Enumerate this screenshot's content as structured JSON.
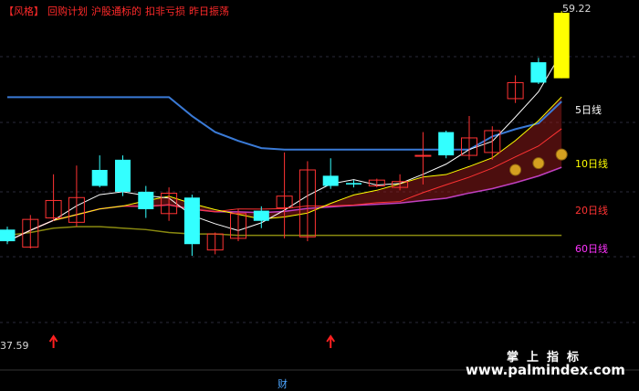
{
  "signals": {
    "style_tag": "【风格】",
    "items": [
      "回购计划",
      "沪股通标的",
      "扣非亏损",
      "昨日振荡"
    ]
  },
  "ma_labels": [
    {
      "key": "ma5",
      "text": "5日线",
      "color": "#ffffff"
    },
    {
      "key": "ma10",
      "text": "10日线",
      "color": "#ffff00"
    },
    {
      "key": "ma20",
      "text": "20日线",
      "color": "#ff3333"
    },
    {
      "key": "ma60",
      "text": "60日线",
      "color": "#ff33ff"
    }
  ],
  "price_low_label": "37.59",
  "price_high_label": "59.22",
  "finance_mark": "财",
  "watermark": {
    "cn": "掌上指标",
    "url": "www.palmindex.com"
  },
  "colors": {
    "up": "#ff3333",
    "down": "#33ffff",
    "limit_up": "#ffff00",
    "blue_line": "#3a7ad6",
    "olive_line": "#8a8a10",
    "purple_line": "#c040c0",
    "green_band": "#0a7a3a",
    "red_band": "#8a1a1a"
  },
  "chart_data": {
    "type": "candlestick",
    "candles": [
      {
        "o": 44.2,
        "c": 43.4,
        "h": 44.4,
        "l": 43.2,
        "dir": "down"
      },
      {
        "o": 43.0,
        "c": 44.9,
        "h": 45.2,
        "l": 42.9,
        "dir": "up"
      },
      {
        "o": 45.0,
        "c": 46.2,
        "h": 48.0,
        "l": 44.8,
        "dir": "up"
      },
      {
        "o": 44.7,
        "c": 46.4,
        "h": 48.6,
        "l": 44.4,
        "dir": "up"
      },
      {
        "o": 48.3,
        "c": 47.2,
        "h": 49.3,
        "l": 47.1,
        "dir": "down"
      },
      {
        "o": 49.0,
        "c": 46.8,
        "h": 49.3,
        "l": 46.5,
        "dir": "down"
      },
      {
        "o": 46.8,
        "c": 45.6,
        "h": 47.2,
        "l": 45.0,
        "dir": "down"
      },
      {
        "o": 45.3,
        "c": 46.7,
        "h": 47.1,
        "l": 44.8,
        "dir": "up"
      },
      {
        "o": 46.4,
        "c": 43.2,
        "h": 46.6,
        "l": 42.4,
        "dir": "down"
      },
      {
        "o": 42.8,
        "c": 43.9,
        "h": 44.0,
        "l": 42.5,
        "dir": "up"
      },
      {
        "o": 43.6,
        "c": 45.3,
        "h": 45.6,
        "l": 43.4,
        "dir": "up"
      },
      {
        "o": 45.5,
        "c": 44.8,
        "h": 45.8,
        "l": 44.3,
        "dir": "down"
      },
      {
        "o": 45.7,
        "c": 46.5,
        "h": 49.5,
        "l": 43.6,
        "dir": "up"
      },
      {
        "o": 43.7,
        "c": 48.3,
        "h": 48.9,
        "l": 43.4,
        "dir": "up"
      },
      {
        "o": 47.9,
        "c": 47.2,
        "h": 49.1,
        "l": 47.0,
        "dir": "down"
      },
      {
        "o": 47.3,
        "c": 47.4,
        "h": 47.6,
        "l": 47.1,
        "dir": "down"
      },
      {
        "o": 47.6,
        "c": 47.2,
        "h": 47.7,
        "l": 47.1,
        "dir": "up"
      },
      {
        "o": 47.1,
        "c": 47.5,
        "h": 48.0,
        "l": 46.9,
        "dir": "up"
      },
      {
        "o": 49.3,
        "c": 49.3,
        "h": 50.9,
        "l": 47.3,
        "dir": "up"
      },
      {
        "o": 50.9,
        "c": 49.3,
        "h": 51.0,
        "l": 49.1,
        "dir": "down"
      },
      {
        "o": 49.3,
        "c": 50.5,
        "h": 52.0,
        "l": 49.0,
        "dir": "up"
      },
      {
        "o": 49.5,
        "c": 51.0,
        "h": 51.3,
        "l": 49.0,
        "dir": "up"
      },
      {
        "o": 53.2,
        "c": 54.3,
        "h": 54.8,
        "l": 52.9,
        "dir": "up"
      },
      {
        "o": 54.3,
        "c": 55.7,
        "h": 56.0,
        "l": 54.2,
        "dir": "down"
      },
      {
        "o": 54.6,
        "c": 59.1,
        "h": 59.22,
        "l": 54.6,
        "dir": "limit"
      }
    ],
    "y_range": [
      37.0,
      59.6
    ],
    "lines": {
      "blue": [
        53.3,
        53.3,
        53.3,
        53.3,
        53.3,
        53.3,
        53.3,
        53.3,
        52.0,
        50.9,
        50.3,
        49.8,
        49.7,
        49.7,
        49.7,
        49.7,
        49.7,
        49.7,
        49.7,
        49.7,
        49.7,
        50.6,
        51.1,
        51.5,
        53.0
      ],
      "olive": [
        43.8,
        44.0,
        44.3,
        44.4,
        44.4,
        44.3,
        44.2,
        44.0,
        43.9,
        43.9,
        43.8,
        43.8,
        43.8,
        43.8,
        43.8,
        43.8,
        43.8,
        43.8,
        43.8,
        43.8,
        43.8,
        43.8,
        43.8,
        43.8,
        43.8
      ]
    },
    "signal_arrows_at": [
      2,
      14
    ],
    "coin_markers_at": [
      22,
      23,
      24
    ]
  }
}
